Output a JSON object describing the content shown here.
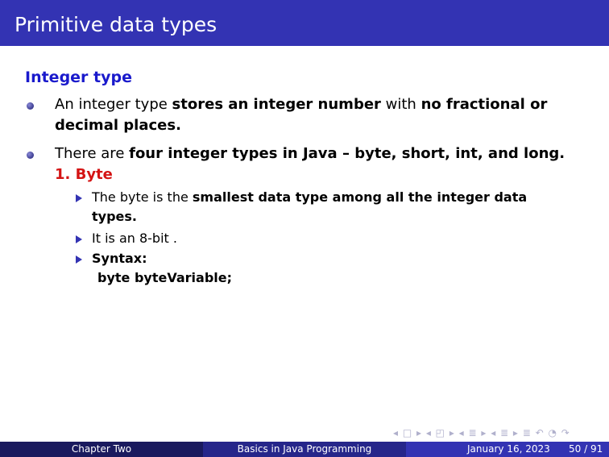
{
  "title": "Primitive data types",
  "block_title": "Integer type",
  "bullets": [
    {
      "pre": "An integer type ",
      "b1": "stores an integer number",
      "mid": " with ",
      "b2": "no fractional or decimal places."
    },
    {
      "pre": "There are ",
      "b1": "four integer types in Java – byte, short, int, and long."
    }
  ],
  "enum_label": "1. Byte",
  "sub_items": [
    {
      "pre": "The byte is the ",
      "bold": "smallest data type among all the integer data types."
    },
    {
      "pre": "It is an 8-bit ."
    },
    {
      "bold": "Syntax:",
      "code": "byte byteVariable;"
    }
  ],
  "nav_symbols": "◂ □ ▸ ◂ ◰ ▸ ◂ ≣ ▸ ◂ ≣ ▸   ≣   ↶ ◔ ↷",
  "footer": {
    "left": "Chapter Two",
    "center": "Basics in Java Programming",
    "date": "January 16, 2023",
    "page": "50 / 91"
  },
  "colors": {
    "accent": "#3333b3",
    "footer_left": "#1a1a5e",
    "footer_center": "#26268a",
    "heading": "#1a1acc",
    "enum": "#d41414"
  }
}
